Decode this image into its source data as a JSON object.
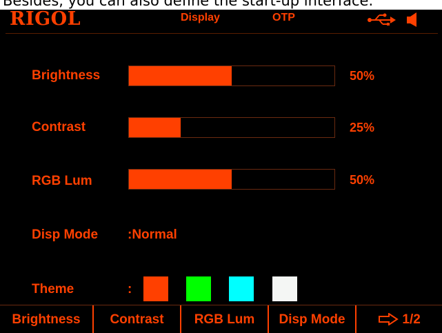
{
  "caption": {
    "text": "Besides, you can also define the start-up interface."
  },
  "header": {
    "logo": "RIGOL",
    "menu_display": "Display",
    "menu_otp": "OTP",
    "status_icons": [
      "usb-icon",
      "speaker-icon"
    ]
  },
  "settings": {
    "brightness": {
      "label": "Brightness",
      "percent_text": "50%",
      "level": 0.5
    },
    "contrast": {
      "label": "Contrast",
      "percent_text": "25%",
      "level": 0.25
    },
    "rgb_lum": {
      "label": "RGB Lum",
      "percent_text": "50%",
      "level": 0.5
    },
    "disp_mode": {
      "label": "Disp Mode",
      "value": ":Normal"
    },
    "theme": {
      "label": "Theme",
      "separator": ":",
      "swatches": [
        "#ff4000",
        "#00ff00",
        "#00ffff",
        "#f4f6f4"
      ]
    }
  },
  "softkeys": {
    "brightness": "Brightness",
    "contrast": "Contrast",
    "rgb_lum": "RGB Lum",
    "disp_mode": "Disp Mode",
    "page": "1/2",
    "page_icon": "arrow-right-icon"
  },
  "colors": {
    "accent": "#ff4000",
    "background": "#000000"
  }
}
